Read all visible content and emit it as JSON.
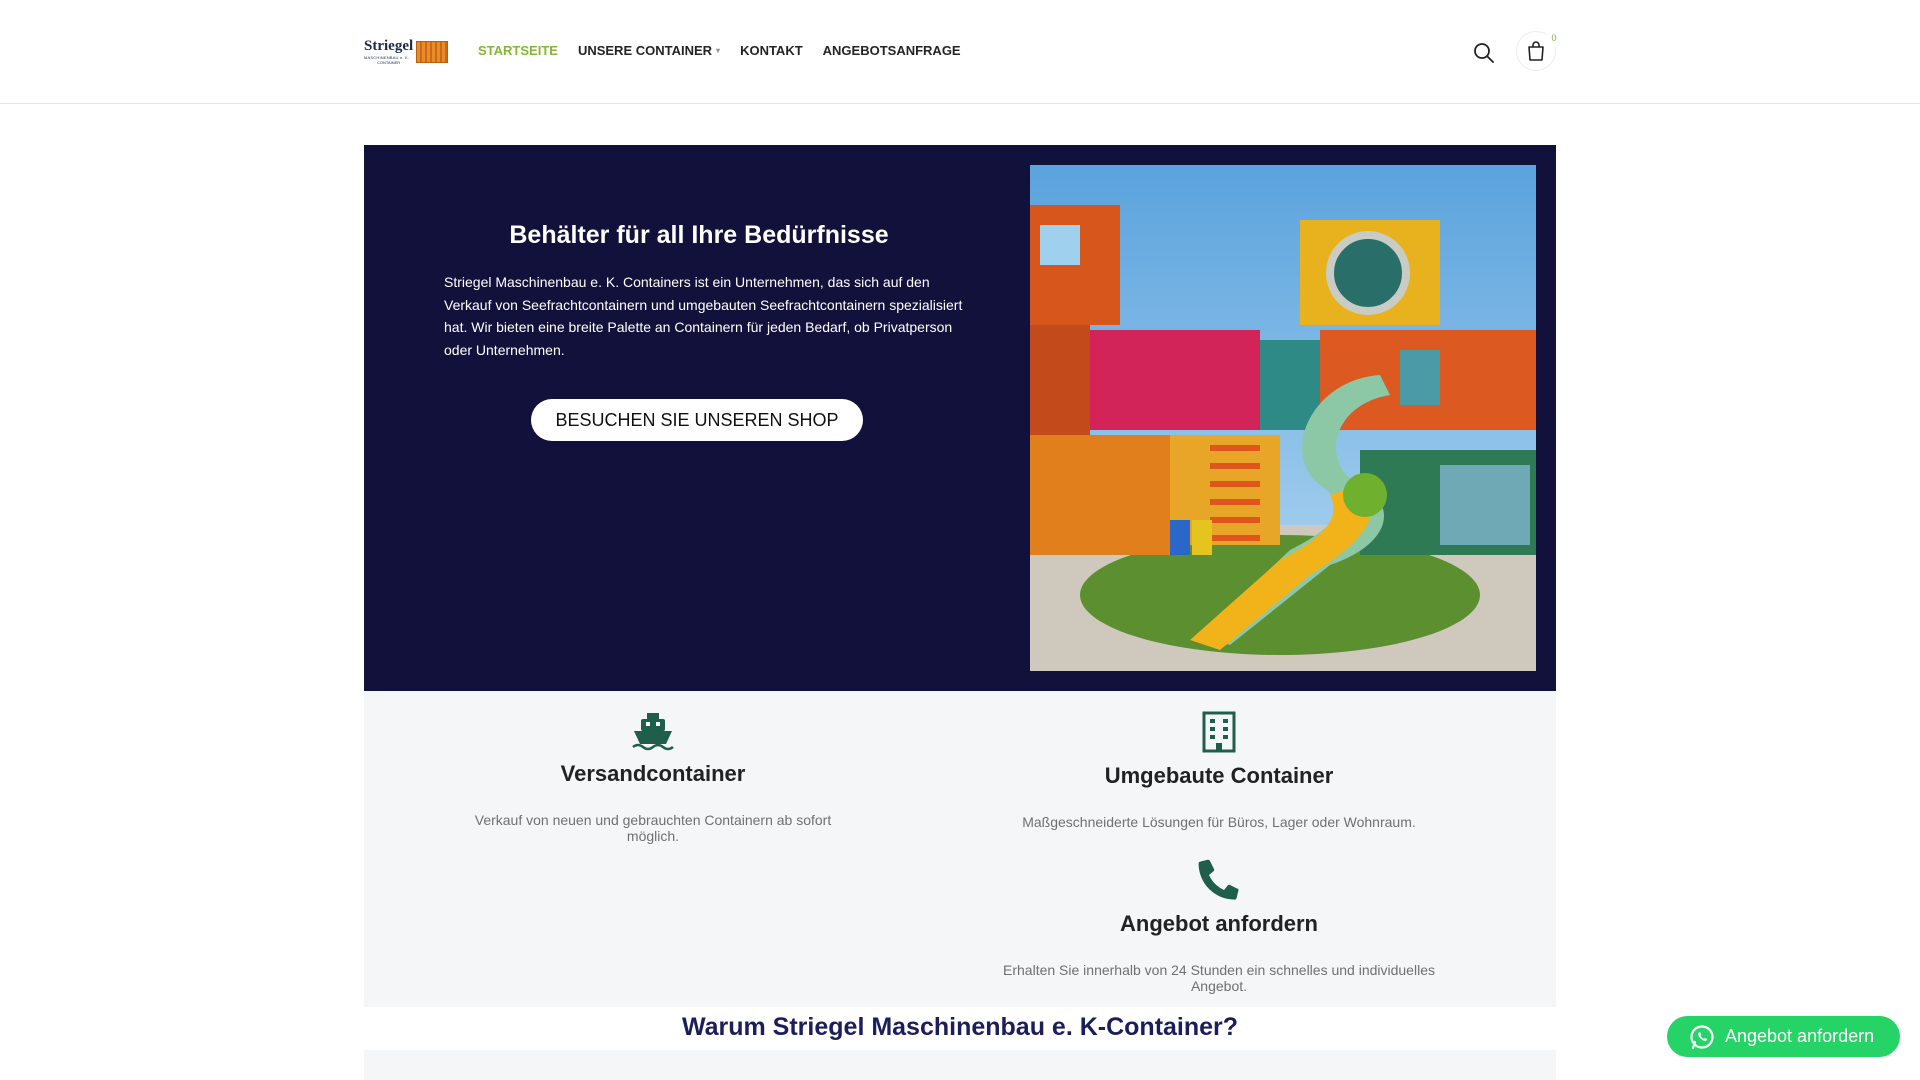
{
  "logo": {
    "name": "Striegel",
    "sub": "MASCHINENBAU e. K.",
    "sub2": "CONTAINER"
  },
  "nav": [
    {
      "label": "STARTSEITE",
      "active": true
    },
    {
      "label": "UNSERE CONTAINER",
      "has_caret": true
    },
    {
      "label": "KONTAKT"
    },
    {
      "label": "ANGEBOTSANFRAGE"
    }
  ],
  "cart": {
    "count": "0",
    "icon": "shopping-bag-icon"
  },
  "search": {
    "icon": "search-icon"
  },
  "hero": {
    "title": "Behälter für all Ihre Bedürfnisse",
    "text": "Striegel Maschinenbau e. K. Containers ist ein Unternehmen, das sich auf den Verkauf von Seefrachtcontainern und umgebauten Seefrachtcontainern spezialisiert hat. Wir bieten eine breite Palette an Containern für jeden Bedarf, ob Privatperson oder Unternehmen.",
    "button": "BESUCHEN SIE UNSEREN SHOP",
    "background": "#11113b"
  },
  "features": [
    {
      "icon": "ship-icon",
      "title": "Versandcontainer",
      "desc": "Verkauf von neuen und gebrauchten Containern ab sofort möglich."
    },
    {
      "icon": "building-icon",
      "title": "Umgebaute Container",
      "desc": "Maßgeschneiderte Lösungen für Büros, Lager oder Wohnraum."
    },
    {
      "icon": "phone-icon",
      "title": "Angebot anfordern",
      "desc": "Erhalten Sie innerhalb von 24 Stunden ein schnelles und individuelles Angebot."
    }
  ],
  "why": {
    "title": "Warum Striegel Maschinenbau e. K-Container?"
  },
  "whatsapp": {
    "label": "Angebot anfordern",
    "icon": "whatsapp-icon",
    "color": "#25d366"
  },
  "colors": {
    "accent": "#83b735",
    "icon_green": "#1f5e4b",
    "navy": "#11113b"
  }
}
